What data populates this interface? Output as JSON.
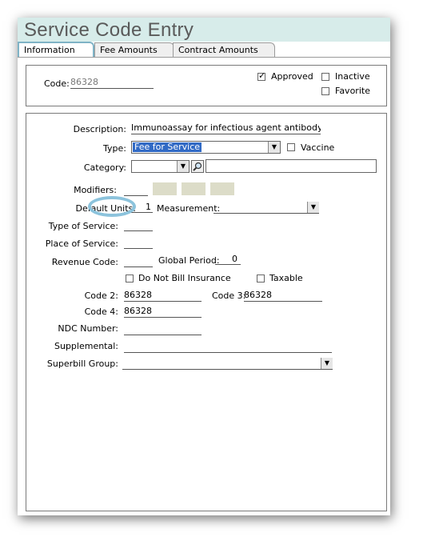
{
  "window": {
    "title": "Service Code Entry"
  },
  "tabs": [
    {
      "label": "Information"
    },
    {
      "label": "Fee Amounts"
    },
    {
      "label": "Contract Amounts"
    }
  ],
  "header": {
    "code_label": "Code:",
    "code_value": "86328",
    "approved_label": "Approved",
    "approved_checked": true,
    "inactive_label": "Inactive",
    "inactive_checked": false,
    "favorite_label": "Favorite",
    "favorite_checked": false
  },
  "form": {
    "description_label": "Description:",
    "description_value": "Immunoassay for infectious agent antibody(ies)  c",
    "type_label": "Type:",
    "type_value": "Fee for Service",
    "vaccine_label": "Vaccine",
    "category_label": "Category:",
    "category_value": "",
    "modifiers_label": "Modifiers:",
    "default_units_label": "Default Units:",
    "default_units_value": "1",
    "measurement_label": "Measurement:",
    "measurement_value": "",
    "type_of_service_label": "Type of Service:",
    "place_of_service_label": "Place of Service:",
    "revenue_code_label": "Revenue Code:",
    "global_period_label": "Global Period:",
    "global_period_value": "0",
    "do_not_bill_label": "Do Not Bill Insurance",
    "taxable_label": "Taxable",
    "code2_label": "Code 2:",
    "code2_value": "86328",
    "code3_label": "Code 3:",
    "code3_value": "86328",
    "code4_label": "Code 4:",
    "code4_value": "86328",
    "ndc_label": "NDC Number:",
    "supplemental_label": "Supplemental:",
    "superbill_label": "Superbill Group:"
  },
  "icons": {
    "check": "✓",
    "dropdown": "▼",
    "search": "magnifier-icon"
  },
  "colors": {
    "titlebar": "#d7ecea",
    "selection": "#316ac5",
    "highlight_circle": "#8cc3dc",
    "modifier_box": "#dcdcc8"
  }
}
